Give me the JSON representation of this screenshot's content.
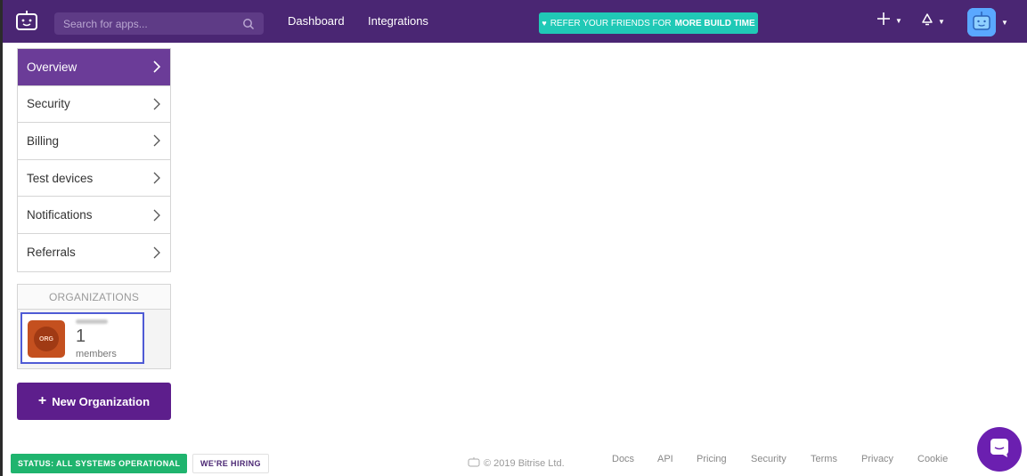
{
  "header": {
    "search": {
      "placeholder": "Search for apps..."
    },
    "nav": [
      "Dashboard",
      "Integrations"
    ],
    "refer_prefix": "REFER YOUR FRIENDS FOR",
    "refer_strong": "MORE BUILD TIME",
    "icons": [
      "bitrise-logo-icon",
      "search-icon",
      "plus-icon",
      "bell-icon",
      "user-avatar-icon",
      "chevron-down-icon"
    ]
  },
  "sidebar": {
    "items": [
      {
        "label": "Overview",
        "active": true
      },
      {
        "label": "Security",
        "active": false
      },
      {
        "label": "Billing",
        "active": false
      },
      {
        "label": "Test devices",
        "active": false
      },
      {
        "label": "Notifications",
        "active": false
      },
      {
        "label": "Referrals",
        "active": false
      }
    ]
  },
  "organizations": {
    "heading": "ORGANIZATIONS",
    "list": [
      {
        "logo_text": "ORG",
        "member_count": "1",
        "members_label": "members"
      }
    ],
    "new_button": "New Organization"
  },
  "footer": {
    "status": "STATUS: ALL SYSTEMS OPERATIONAL",
    "hiring": "WE'RE HIRING",
    "copyright": "© 2019 Bitrise Ltd.",
    "links": [
      "Docs",
      "API",
      "Pricing",
      "Security",
      "Terms",
      "Privacy",
      "Cookie"
    ]
  },
  "colors": {
    "topbar": "#4a2673",
    "accent": "#6b3c98",
    "refer": "#20c9b6",
    "status": "#1fb46e",
    "new_org": "#5d1e8c",
    "org_highlight": "#4f5bd5"
  }
}
